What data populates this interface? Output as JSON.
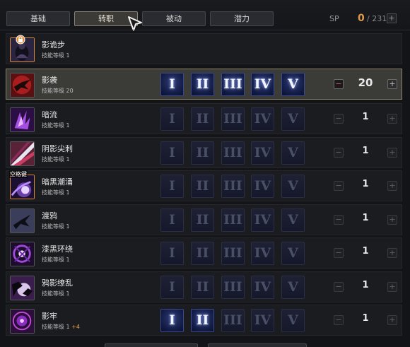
{
  "tabs": [
    {
      "label": "基础",
      "active": false
    },
    {
      "label": "转职",
      "active": true
    },
    {
      "label": "被动",
      "active": false
    },
    {
      "label": "潜力",
      "active": false
    }
  ],
  "sp": {
    "label": "SP",
    "value": "0",
    "max": "/ 231",
    "plus": "+"
  },
  "rune_labels": [
    "I",
    "II",
    "III",
    "IV",
    "V"
  ],
  "level_prefix": "技能等级",
  "skills": [
    {
      "name": "影诡步",
      "level": "1",
      "bonus": "",
      "count": "",
      "runes_on": [],
      "selected": false,
      "icon": "shadow-step-icon",
      "space_tag": "",
      "unlocked_badge": true,
      "show_runes": false
    },
    {
      "name": "影袭",
      "level": "20",
      "bonus": "",
      "count": "20",
      "runes_on": [
        0,
        1,
        2,
        3,
        4
      ],
      "selected": true,
      "icon": "shadow-raid-icon",
      "space_tag": "",
      "unlocked_badge": false,
      "show_runes": true
    },
    {
      "name": "暗流",
      "level": "1",
      "bonus": "",
      "count": "1",
      "runes_on": [],
      "selected": false,
      "icon": "undercurrent-icon",
      "space_tag": "",
      "unlocked_badge": false,
      "show_runes": true
    },
    {
      "name": "阴影尖刺",
      "level": "1",
      "bonus": "",
      "count": "1",
      "runes_on": [],
      "selected": false,
      "icon": "shadow-spike-icon",
      "space_tag": "",
      "unlocked_badge": false,
      "show_runes": true
    },
    {
      "name": "暗黑潮涌",
      "level": "1",
      "bonus": "",
      "count": "1",
      "runes_on": [],
      "selected": false,
      "icon": "dark-surge-icon",
      "space_tag": "空格键",
      "unlocked_badge": false,
      "show_runes": true
    },
    {
      "name": "渡鸦",
      "level": "1",
      "bonus": "",
      "count": "1",
      "runes_on": [],
      "selected": false,
      "icon": "raven-icon",
      "space_tag": "",
      "unlocked_badge": false,
      "show_runes": true
    },
    {
      "name": "漆黑环绕",
      "level": "1",
      "bonus": "",
      "count": "1",
      "runes_on": [],
      "selected": false,
      "icon": "dark-encircle-icon",
      "space_tag": "",
      "unlocked_badge": false,
      "show_runes": true
    },
    {
      "name": "鸦影缭乱",
      "level": "1",
      "bonus": "",
      "count": "1",
      "runes_on": [],
      "selected": false,
      "icon": "raven-frenzy-icon",
      "space_tag": "",
      "unlocked_badge": false,
      "show_runes": true
    },
    {
      "name": "影牢",
      "level": "1",
      "bonus": "+4",
      "count": "1",
      "runes_on": [
        0,
        1
      ],
      "selected": false,
      "icon": "shadow-prison-icon",
      "space_tag": "",
      "unlocked_badge": false,
      "show_runes": true
    }
  ],
  "colors": {
    "accent": "#e19a4b",
    "rune_on": "#2d3a73",
    "selected_border": "#8b8068"
  }
}
